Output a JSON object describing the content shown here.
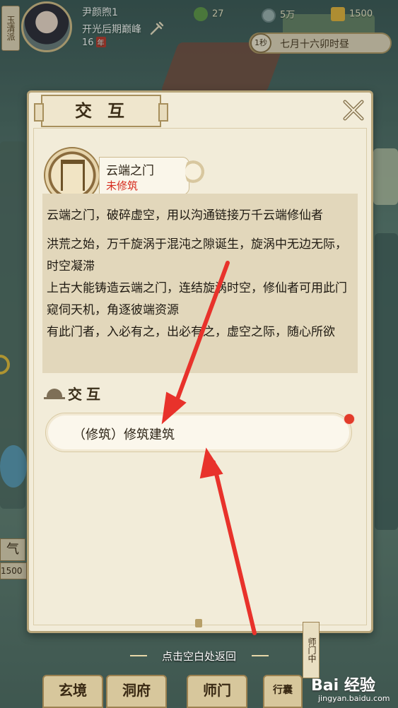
{
  "player": {
    "sect": "玉清派",
    "name": "尹颜煦1",
    "realm": "开光后期巅峰",
    "age": "16",
    "age_unit": "年"
  },
  "resources": [
    {
      "icon": "leaf-icon",
      "value": "27"
    },
    {
      "icon": "coin-icon",
      "value": "5万"
    },
    {
      "icon": "gold-cross-icon",
      "value": "1500"
    }
  ],
  "time": {
    "speed": "1秒",
    "label": "七月十六卯时昼"
  },
  "dialog": {
    "title": "交互",
    "building_name": "云端之门",
    "building_status": "未修筑",
    "description": [
      "云端之门，破碎虚空，用以沟通链接万千云端修仙者",
      "洪荒之始，万千旋涡于混沌之隙诞生，旋涡中无边无际，时空凝滞",
      "上古大能铸造云端之门，连结旋涡时空，修仙者可用此门窥伺天机，角逐彼端资源",
      "有此门者，入必有之，出必有之，虚空之际，随心所欲"
    ],
    "section_title": "交互",
    "actions": [
      {
        "label": "（修筑）修筑建筑",
        "has_alert": true
      }
    ]
  },
  "footer": {
    "back_hint": "点击空白处返回",
    "nav": [
      {
        "label": "玄境"
      },
      {
        "label": "洞府"
      },
      {
        "label": "师门"
      },
      {
        "label": "行囊"
      }
    ],
    "side_tag": "师门中",
    "left_chip_1": "气",
    "left_chip_2": "1500"
  },
  "watermark": {
    "main": "Bai 经验",
    "sub": "jingyan.baidu.com"
  },
  "colors": {
    "status_red": "#d62c1f",
    "arrow_red": "#e8322b",
    "panel": "#f2ecd9",
    "desc_bg": "#e2d7bb"
  }
}
